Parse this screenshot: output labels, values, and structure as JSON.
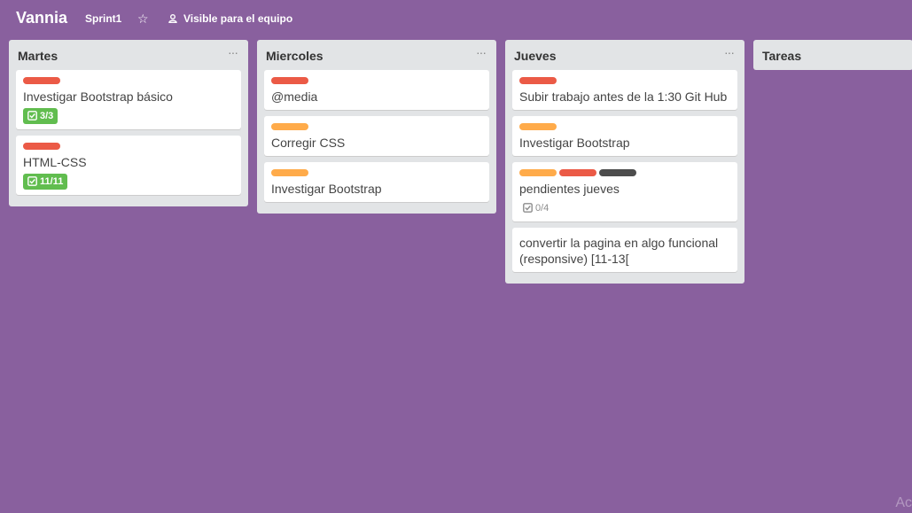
{
  "header": {
    "title": "Vannia",
    "board_name": "Sprint1",
    "star_icon": "star-icon",
    "visibility": "Visible para el equipo"
  },
  "colors": {
    "background": "#89609e",
    "red": "#eb5a46",
    "orange": "#ffab4a",
    "dark": "#4d4d4d",
    "green": "#61bd4f"
  },
  "lists": [
    {
      "title": "Martes",
      "cards": [
        {
          "labels": [
            "red"
          ],
          "title": "Investigar Bootstrap básico",
          "badge": "3/3",
          "badge_complete": true
        },
        {
          "labels": [
            "red"
          ],
          "title": "HTML-CSS",
          "badge": "11/11",
          "badge_complete": true
        }
      ]
    },
    {
      "title": "Miercoles",
      "cards": [
        {
          "labels": [
            "red"
          ],
          "title": "@media"
        },
        {
          "labels": [
            "orange"
          ],
          "title": "Corregir CSS"
        },
        {
          "labels": [
            "orange"
          ],
          "title": "Investigar Bootstrap"
        }
      ]
    },
    {
      "title": "Jueves",
      "cards": [
        {
          "labels": [
            "red"
          ],
          "title": "Subir trabajo antes de la 1:30 Git Hub"
        },
        {
          "labels": [
            "orange"
          ],
          "title": "Investigar Bootstrap"
        },
        {
          "labels": [
            "orange",
            "red",
            "dark"
          ],
          "title": "pendientes jueves",
          "badge": "0/4",
          "badge_complete": false
        },
        {
          "labels": [],
          "title": "convertir la pagina en algo funcional (responsive) [11-13["
        }
      ]
    },
    {
      "title": "Tareas",
      "cards": []
    }
  ],
  "watermark": "Ac"
}
